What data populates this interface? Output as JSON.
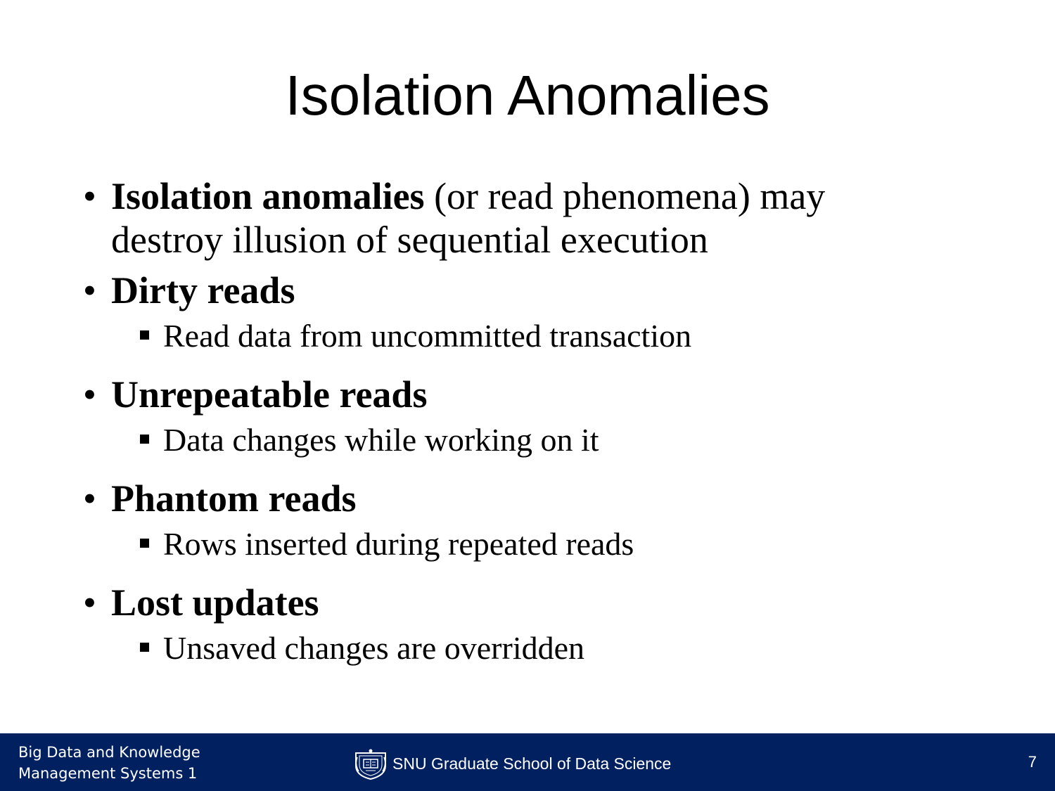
{
  "slide": {
    "title": "Isolation Anomalies",
    "bullets": [
      {
        "bold": "Isolation anomalies",
        "rest_line1": " (or read phenomena) may",
        "rest_line2": "destroy illusion of sequential execution"
      },
      {
        "bold": "Dirty reads",
        "sub": "Read data from uncommitted transaction"
      },
      {
        "bold": "Unrepeatable reads",
        "sub": "Data changes while working on it"
      },
      {
        "bold": "Phantom reads",
        "sub": "Rows inserted during repeated reads"
      },
      {
        "bold": "Lost updates",
        "sub": "Unsaved changes are overridden"
      }
    ]
  },
  "footer": {
    "course_line1": "Big Data and Knowledge",
    "course_line2": "Management Systems 1",
    "school": "SNU Graduate School of Data Science",
    "page_number": "7",
    "logo_icon": "snu-seal-icon",
    "background_color": "#002060"
  }
}
